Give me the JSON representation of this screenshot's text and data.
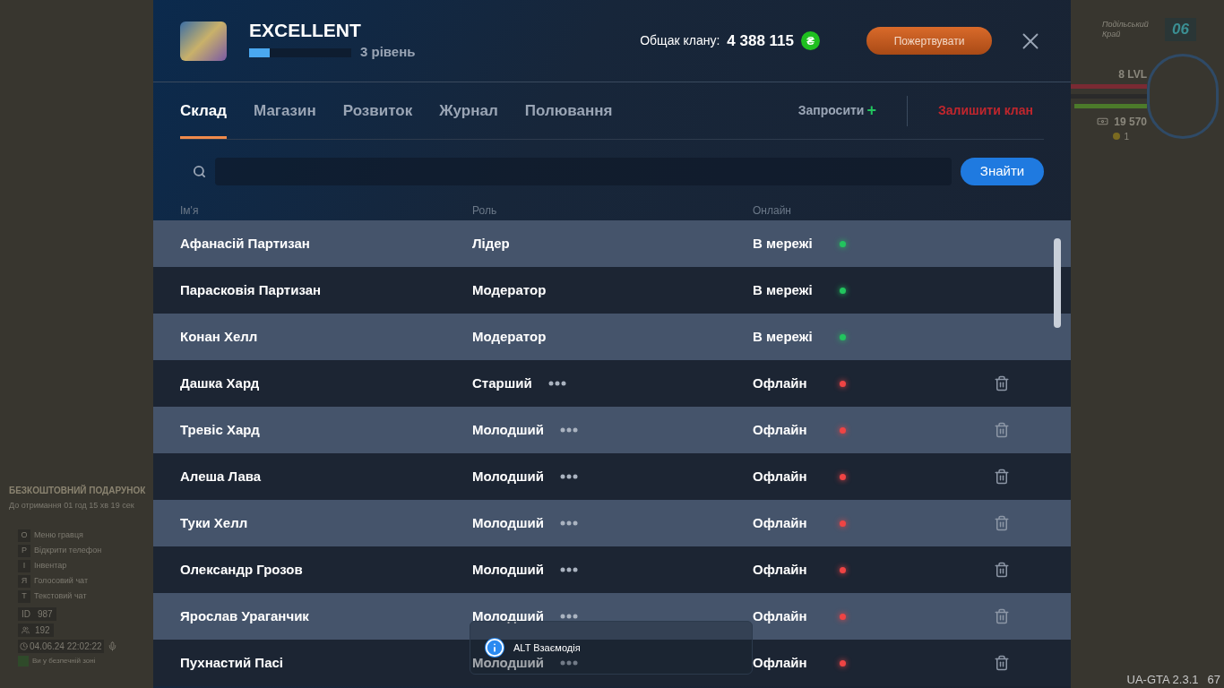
{
  "clan": {
    "name": "EXCELLENT",
    "level": 0.2,
    "level_label": "3 рівень",
    "treasury_label": "Общак клану:",
    "treasury_value": "4 388 115",
    "currency_symbol": "₴",
    "donate_button": "Пожертвувати"
  },
  "tabs": [
    {
      "label": "Склад",
      "selected": true
    },
    {
      "label": "Магазин",
      "selected": false
    },
    {
      "label": "Розвиток",
      "selected": false
    },
    {
      "label": "Журнал",
      "selected": false
    },
    {
      "label": "Полювання",
      "selected": false
    }
  ],
  "invite_button": "Запросити",
  "plus": "+",
  "leave_button": "Залишити клан",
  "search": {
    "button": "Знайти"
  },
  "table": {
    "columns": [
      "Ім'я",
      "Роль",
      "Онлайн"
    ],
    "rows": [
      {
        "name": "Афанасій Партизан",
        "role": "Лідер",
        "status": "В мережі",
        "online": true,
        "role_menu": false,
        "deletable": false
      },
      {
        "name": "Парасковія Партизан",
        "role": "Модератор",
        "status": "В мережі",
        "online": true,
        "role_menu": false,
        "deletable": false
      },
      {
        "name": "Конан Хелл",
        "role": "Модератор",
        "status": "В мережі",
        "online": true,
        "role_menu": false,
        "deletable": false
      },
      {
        "name": "Дашка Хард",
        "role": "Старший",
        "status": "Офлайн",
        "online": false,
        "role_menu": true,
        "deletable": true
      },
      {
        "name": "Тревіс Хард",
        "role": "Молодший",
        "status": "Офлайн",
        "online": false,
        "role_menu": true,
        "deletable": true
      },
      {
        "name": "Алеша Лава",
        "role": "Молодший",
        "status": "Офлайн",
        "online": false,
        "role_menu": true,
        "deletable": true
      },
      {
        "name": "Туки Хелл",
        "role": "Молодший",
        "status": "Офлайн",
        "online": false,
        "role_menu": true,
        "deletable": true
      },
      {
        "name": "Олександр Грозов",
        "role": "Молодший",
        "status": "Офлайн",
        "online": false,
        "role_menu": true,
        "deletable": true
      },
      {
        "name": "Ярослав Ураганчик",
        "role": "Молодший",
        "status": "Офлайн",
        "online": false,
        "role_menu": true,
        "deletable": true
      },
      {
        "name": "Пухнастий Пасі",
        "role": "Молодший",
        "status": "Офлайн",
        "online": false,
        "role_menu": true,
        "deletable": true
      }
    ]
  },
  "hint": {
    "key": "ALT",
    "text": "Взаємодія"
  },
  "hud_right": {
    "region": "Подільський Край",
    "zone": "06",
    "lvl": "8 LVL",
    "money": "19 570",
    "coins": "1"
  },
  "hud_left": {
    "gift_title": "БЕЗКОШТОВНИЙ ПОДАРУНОК",
    "gift_timer": "До отримання 01 год 15 хв 19 сек",
    "hotkeys": [
      {
        "key": "O",
        "label": "Меню гравця"
      },
      {
        "key": "P",
        "label": "Відкрити телефон"
      },
      {
        "key": "I",
        "label": "Інвентар"
      },
      {
        "key": "Я",
        "label": "Голосовий чат"
      },
      {
        "key": "T",
        "label": "Текстовий чат"
      }
    ],
    "id_label": "ID",
    "id": "987",
    "players": "192",
    "datetime": "04.06.24 22:02:22",
    "safe_zone": "Ви у безпечній зоні"
  },
  "version": "UA-GTA 2.3.1",
  "fps": "67"
}
